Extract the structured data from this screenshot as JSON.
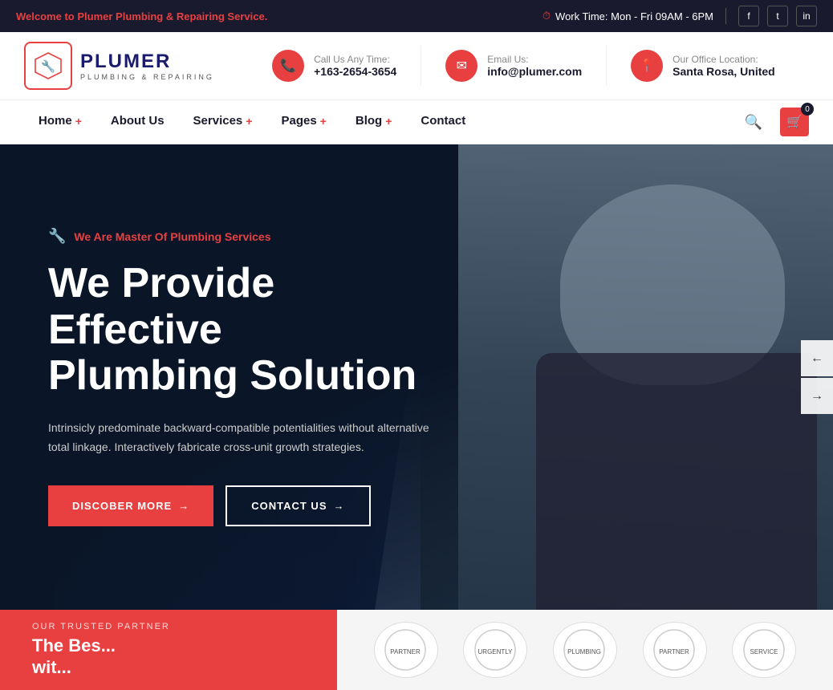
{
  "topbar": {
    "welcome_text": "Welcome to ",
    "brand_name": "Plumer",
    "welcome_suffix": " Plumbing & Repairing Service.",
    "work_time_label": "Work Time: Mon - Fri 09AM - 6PM",
    "socials": [
      "f",
      "t",
      "in"
    ]
  },
  "header": {
    "logo_title": "PLUMER",
    "logo_subtitle": "PLUMBING & REPAIRING",
    "contact1_label": "Call Us Any Time:",
    "contact1_value": "+163-2654-3654",
    "contact2_label": "Email Us:",
    "contact2_value": "info@plumer.com",
    "contact3_label": "Our Office Location:",
    "contact3_value": "Santa Rosa, United",
    "cart_count": "0"
  },
  "nav": {
    "items": [
      {
        "label": "Home",
        "has_plus": true
      },
      {
        "label": "About Us",
        "has_plus": false
      },
      {
        "label": "Services",
        "has_plus": true
      },
      {
        "label": "Pages",
        "has_plus": true
      },
      {
        "label": "Blog",
        "has_plus": true
      },
      {
        "label": "Contact",
        "has_plus": false
      }
    ]
  },
  "hero": {
    "tag": "We Are Master Of Plumbing Services",
    "title_line1": "We Provide Effective",
    "title_line2": "Plumbing Solution",
    "description": "Intrinsicly predominate backward-compatible potentialities without alternative total linkage. Interactively fabricate cross-unit growth strategies.",
    "btn_primary": "DISCOBER MORE",
    "btn_secondary": "CONTACT US"
  },
  "trusted": {
    "label": "OUR TRUSTED PARTNER",
    "title_line1": "The Bes...",
    "title_line2": "wit..."
  }
}
